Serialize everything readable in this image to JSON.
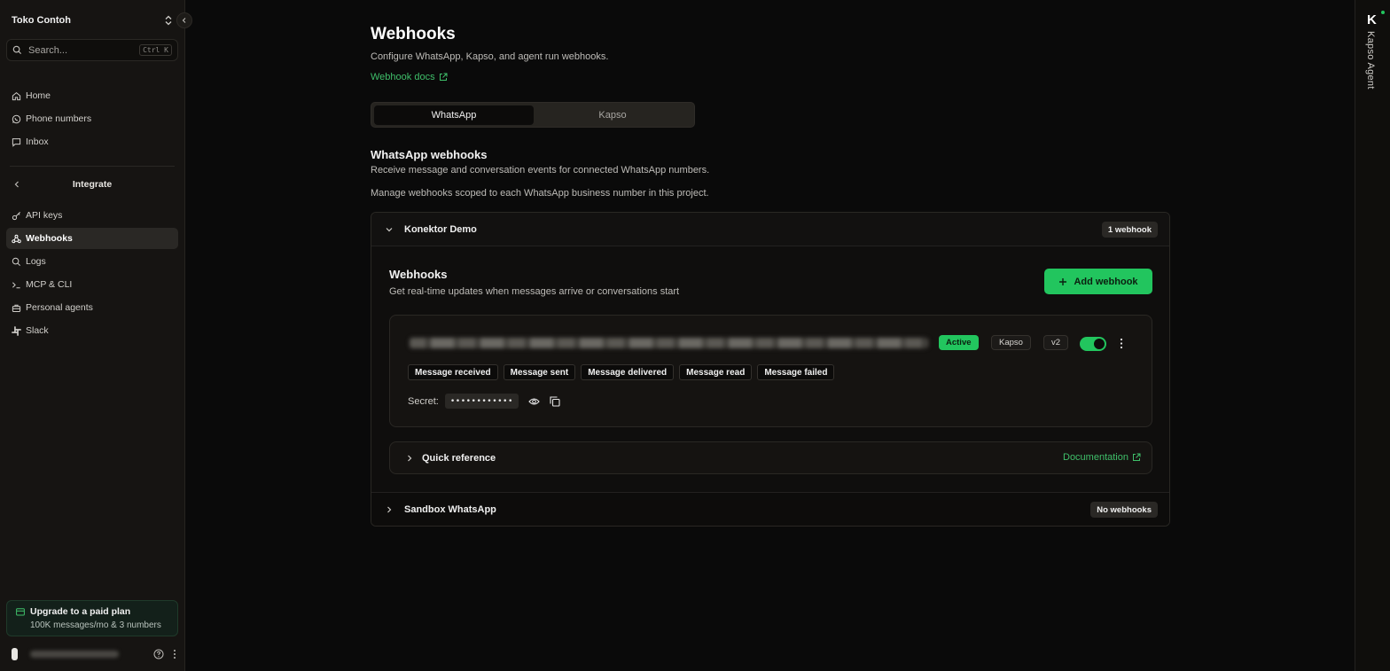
{
  "sidebar": {
    "workspace_name": "Toko Contoh",
    "search_placeholder": "Search...",
    "search_shortcut": "Ctrl K",
    "nav": [
      {
        "label": "Home",
        "icon": "home-icon"
      },
      {
        "label": "Phone numbers",
        "icon": "whatsapp-icon"
      },
      {
        "label": "Inbox",
        "icon": "message-icon"
      }
    ],
    "group_title": "Integrate",
    "group_items": [
      {
        "label": "API keys",
        "icon": "key-icon",
        "active": false
      },
      {
        "label": "Webhooks",
        "icon": "webhook-icon",
        "active": true
      },
      {
        "label": "Logs",
        "icon": "search-icon",
        "active": false
      },
      {
        "label": "MCP & CLI",
        "icon": "terminal-icon",
        "active": false
      },
      {
        "label": "Personal agents",
        "icon": "briefcase-icon",
        "active": false
      },
      {
        "label": "Slack",
        "icon": "slack-icon",
        "active": false
      }
    ],
    "upgrade_title": "Upgrade to a paid plan",
    "upgrade_subtitle": "100K messages/mo & 3 numbers"
  },
  "page": {
    "title": "Webhooks",
    "subtitle": "Configure WhatsApp, Kapso, and agent run webhooks.",
    "docs_link": "Webhook docs",
    "tabs": [
      "WhatsApp",
      "Kapso"
    ],
    "active_tab": "WhatsApp",
    "section_title": "WhatsApp webhooks",
    "section_subtitle": "Receive message and conversation events for connected WhatsApp numbers.",
    "section_note": "Manage webhooks scoped to each WhatsApp business number in this project."
  },
  "numbers": [
    {
      "name": "Konektor Demo",
      "count_badge": "1 webhook",
      "expanded": true,
      "panel_title": "Webhooks",
      "panel_subtitle": "Get real-time updates when messages arrive or conversations start",
      "add_button": "Add webhook",
      "webhook": {
        "status": "Active",
        "kind": "Kapso",
        "version": "v2",
        "enabled": true,
        "events": [
          "Message received",
          "Message sent",
          "Message delivered",
          "Message read",
          "Message failed"
        ],
        "secret_label": "Secret:",
        "secret_mask": "••••••••••••"
      },
      "quick_reference": "Quick reference",
      "documentation_link": "Documentation"
    },
    {
      "name": "Sandbox WhatsApp",
      "count_badge": "No webhooks",
      "expanded": false
    }
  ],
  "rail": {
    "logo": "K",
    "label": "Kapso Agent"
  },
  "colors": {
    "accent": "#22c55e",
    "link": "#3fbf6a",
    "background": "#0a0a0a",
    "sidebar": "#161412"
  }
}
